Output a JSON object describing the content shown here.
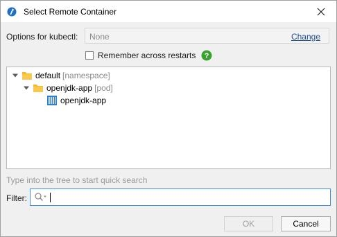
{
  "window": {
    "title": "Select Remote Container"
  },
  "options": {
    "label": "Options for kubectl:",
    "value": "None",
    "change_label": "Change"
  },
  "remember": {
    "label": "Remember across restarts",
    "checked": false
  },
  "tree": {
    "nodes": [
      {
        "label": "default",
        "type": "[namespace]",
        "icon": "folder-icon",
        "expanded": true
      },
      {
        "label": "openjdk-app",
        "type": "[pod]",
        "icon": "folder-icon",
        "expanded": true
      },
      {
        "label": "openjdk-app",
        "type": "",
        "icon": "container-icon"
      }
    ]
  },
  "hint": "Type into the tree to start quick search",
  "filter": {
    "label": "Filter:",
    "value": ""
  },
  "buttons": {
    "ok": "OK",
    "cancel": "Cancel"
  },
  "colors": {
    "accent": "#3f8fd6",
    "folder": "#f5b82e",
    "help": "#3aa12f",
    "link": "#1a4d91"
  }
}
